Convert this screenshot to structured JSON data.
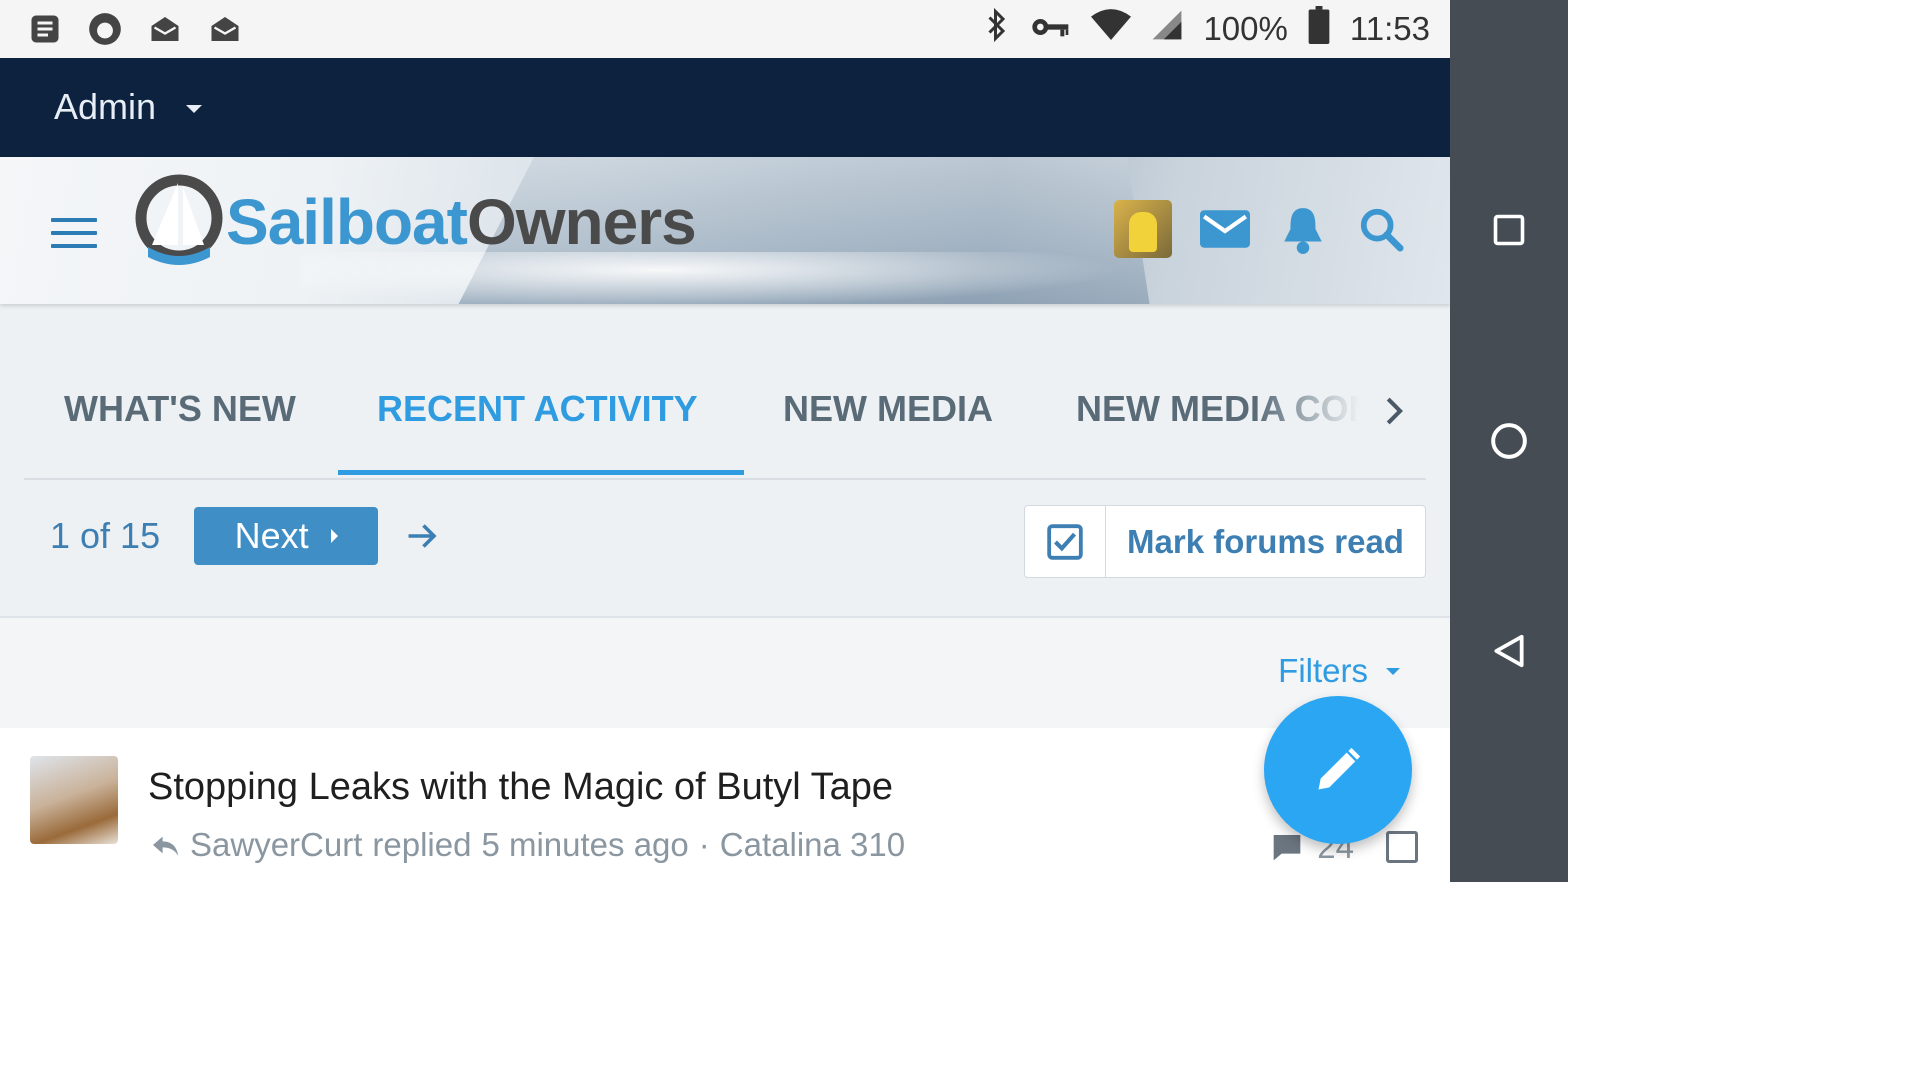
{
  "status_bar": {
    "battery": "100%",
    "time": "11:53",
    "left_icons": [
      "news-icon",
      "firefox-icon",
      "mail-open-icon",
      "mail-open-icon"
    ],
    "right_icons": [
      "bluetooth-icon",
      "vpn-key-icon",
      "wifi-icon",
      "cell-signal-icon",
      "battery-icon"
    ]
  },
  "admin_bar": {
    "label": "Admin"
  },
  "header": {
    "logo_part1": "Sailboat",
    "logo_part2": "Owners"
  },
  "tabs": [
    {
      "label": "WHAT'S NEW",
      "active": false
    },
    {
      "label": "RECENT ACTIVITY",
      "active": true
    },
    {
      "label": "NEW MEDIA",
      "active": false
    },
    {
      "label": "NEW MEDIA COM",
      "active": false
    }
  ],
  "pager": {
    "count": "1 of 15",
    "next_label": "Next"
  },
  "mark_read": {
    "label": "Mark forums read"
  },
  "filters": {
    "label": "Filters"
  },
  "thread": {
    "title": "Stopping Leaks with the Magic of Butyl Tape",
    "author": "SawyerCurt",
    "action": "replied",
    "time": "5 minutes ago",
    "separator": "·",
    "forum": "Catalina 310",
    "reply_count": "24"
  },
  "colors": {
    "admin_bar": "#0c223e",
    "accent": "#2f9be0",
    "button": "#3f8ec6",
    "fab": "#2ba6f3",
    "nav_bar": "#454c54"
  }
}
